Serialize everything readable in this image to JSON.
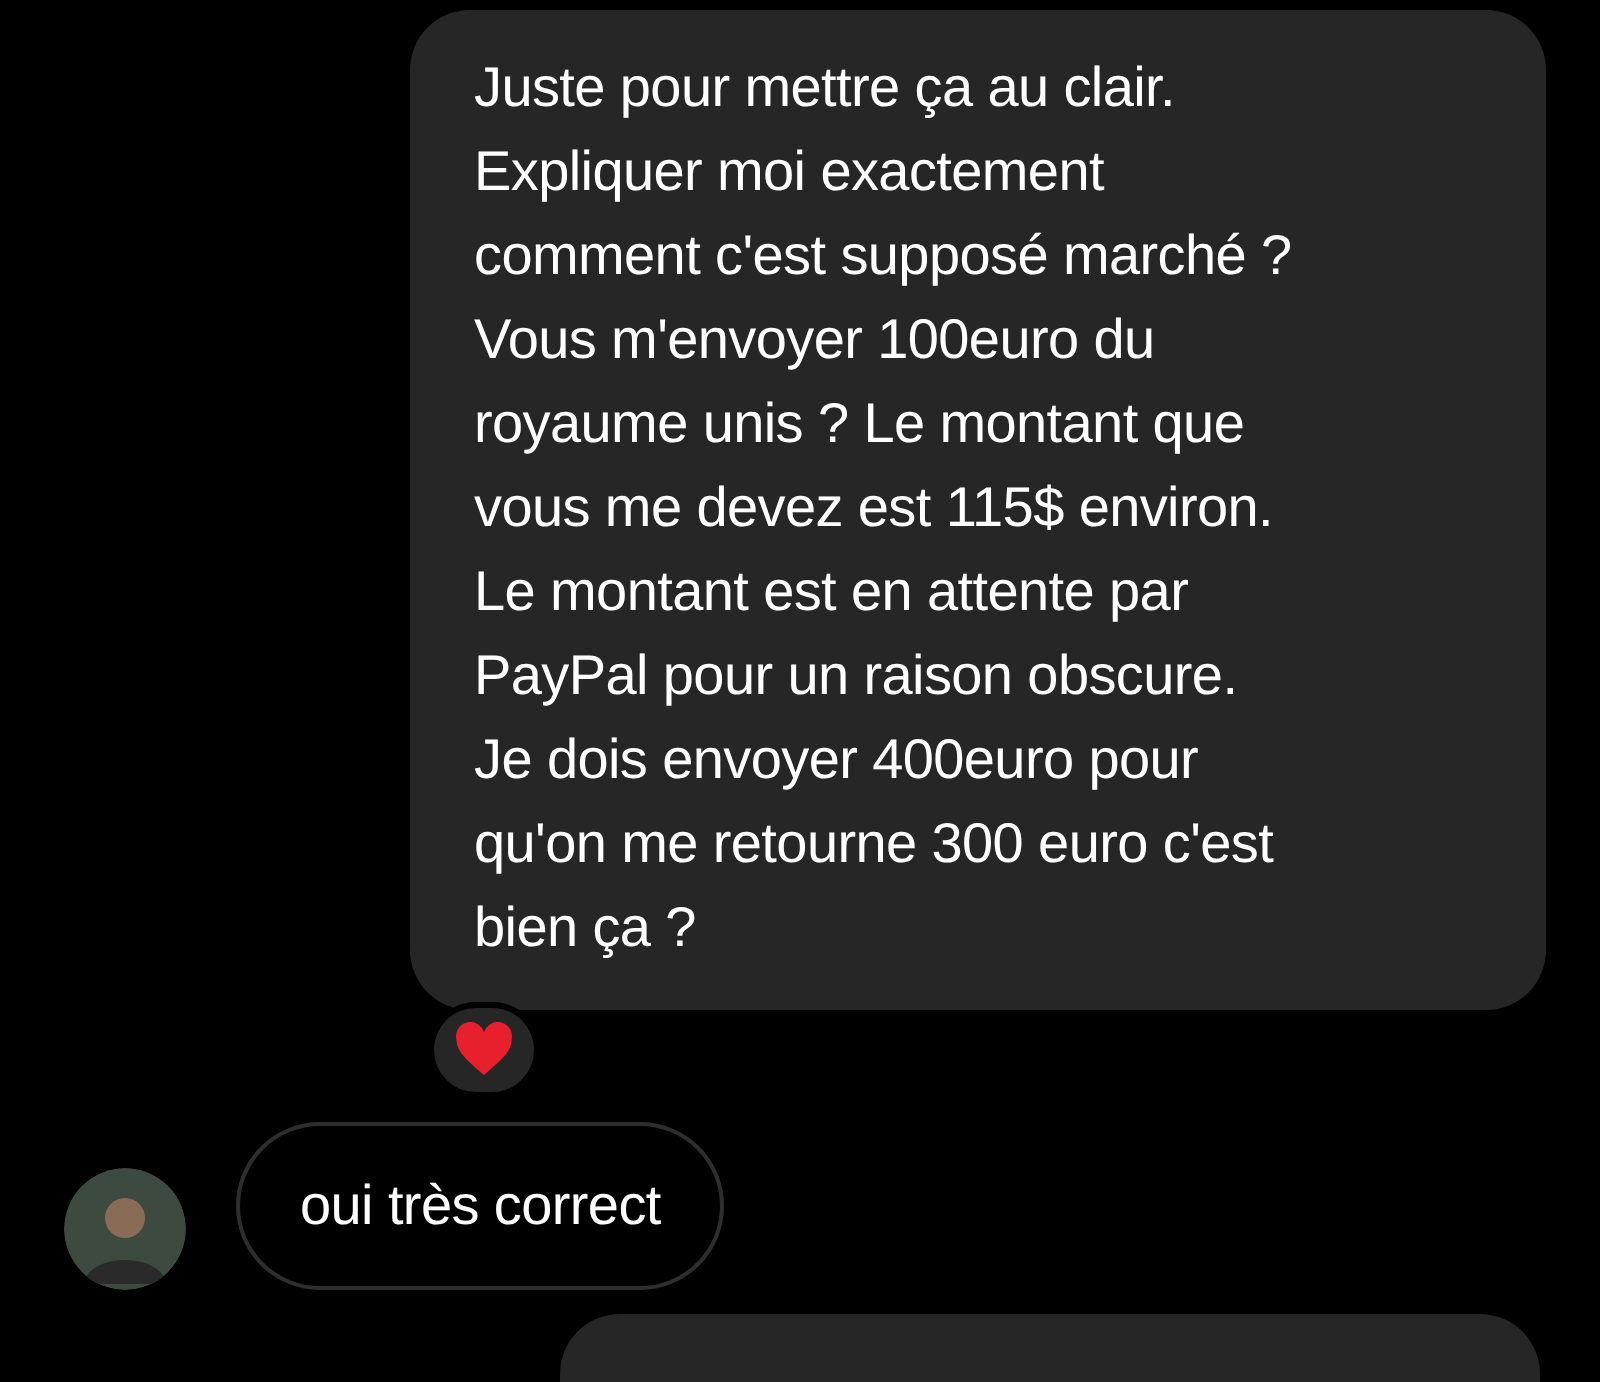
{
  "messages": [
    {
      "kind": "sent",
      "text": "Juste pour mettre ça au clair.\nExpliquer moi exactement\ncomment c'est supposé marché ?\nVous m'envoyer 100euro du\nroyaume unis ? Le montant que\nvous me devez est 115$ environ.\nLe montant est en attente par\nPayPal pour un raison obscure.\nJe dois envoyer 400euro pour\nqu'on me retourne 300 euro c'est\nbien ça ?",
      "reacted": true
    },
    {
      "kind": "received",
      "text": "oui très correct"
    },
    {
      "kind": "sent"
    }
  ]
}
